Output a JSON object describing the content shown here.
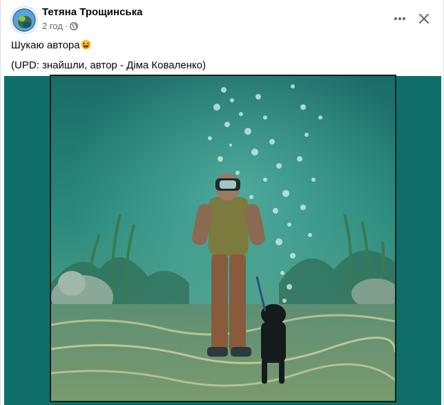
{
  "post": {
    "author": "Тетяна Трощинська",
    "time": "2 год",
    "separator": "·",
    "audience_icon": "globe-icon",
    "text_line1": "Шукаю автора",
    "text_line1_emoji": "grinning-squinting-face",
    "text_line2": "(UPD: знайшли, автор - Діма Коваленко)"
  },
  "actions": {
    "more_icon": "more-horizontal-icon",
    "close_icon": "close-icon"
  },
  "colors": {
    "media_background": "#0f6f68",
    "secondary_text": "#65676b",
    "primary_text": "#050505"
  }
}
